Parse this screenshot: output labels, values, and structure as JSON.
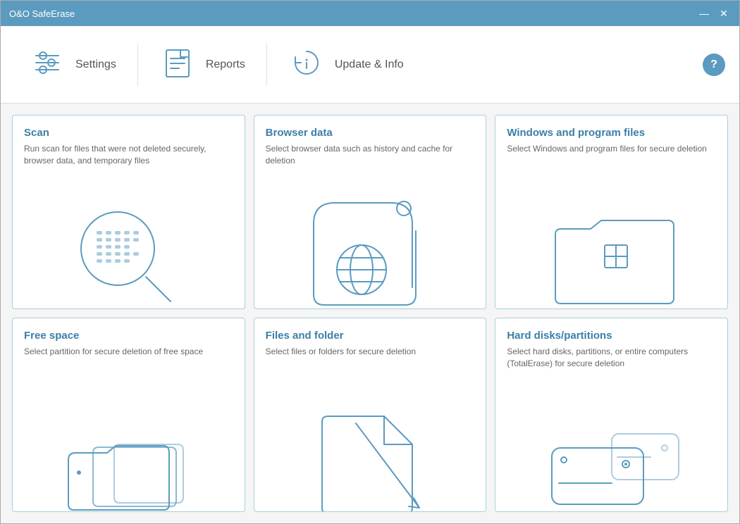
{
  "window": {
    "title": "O&O SafeErase",
    "controls": {
      "minimize": "—",
      "close": "✕"
    }
  },
  "toolbar": {
    "settings": {
      "label": "Settings",
      "icon": "settings-icon"
    },
    "reports": {
      "label": "Reports",
      "icon": "reports-icon"
    },
    "update": {
      "label": "Update & Info",
      "icon": "update-icon"
    },
    "help": "?"
  },
  "cards": [
    {
      "id": "scan",
      "title": "Scan",
      "desc": "Run scan for files that were not deleted securely, browser data, and temporary files",
      "icon": "scan-icon"
    },
    {
      "id": "browser",
      "title": "Browser data",
      "desc": "Select browser data such as history and cache for deletion",
      "icon": "browser-icon"
    },
    {
      "id": "windows",
      "title": "Windows and program files",
      "desc": "Select Windows and program files for secure deletion",
      "icon": "windows-icon"
    },
    {
      "id": "freespace",
      "title": "Free space",
      "desc": "Select partition for secure deletion of free space",
      "icon": "freespace-icon"
    },
    {
      "id": "files",
      "title": "Files and folder",
      "desc": "Select files or folders for secure deletion",
      "icon": "files-icon"
    },
    {
      "id": "harddisk",
      "title": "Hard disks/partitions",
      "desc": "Select hard disks, partitions, or entire computers (TotalErase) for secure deletion",
      "icon": "harddisk-icon"
    }
  ]
}
